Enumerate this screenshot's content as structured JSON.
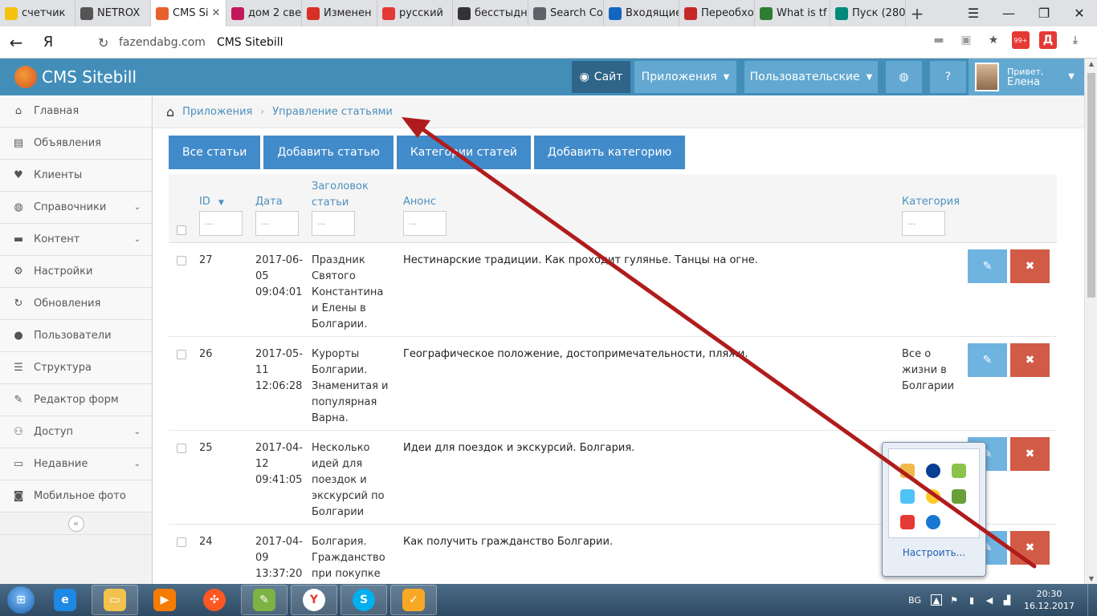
{
  "browser": {
    "tabs": [
      {
        "label": "счетчик",
        "color": "#f4c20d"
      },
      {
        "label": "NETROX",
        "color": "#555555"
      },
      {
        "label": "CMS Si",
        "color": "#e8612c",
        "active": true
      },
      {
        "label": "дом 2 све",
        "color": "#c2185b"
      },
      {
        "label": "Изменен",
        "color": "#d93025"
      },
      {
        "label": "русский",
        "color": "#e53935"
      },
      {
        "label": "бесстыдн",
        "color": "#333333"
      },
      {
        "label": "Search Co",
        "color": "#5f6368"
      },
      {
        "label": "Входящие",
        "color": "#1565c0"
      },
      {
        "label": "Переобхо",
        "color": "#c62828"
      },
      {
        "label": "What is tf",
        "color": "#2e7d32"
      },
      {
        "label": "Пуск (280",
        "color": "#00897b"
      }
    ],
    "tab_close": "✕",
    "new_tab": "+",
    "window_controls": [
      "☰",
      "—",
      "❐",
      "✕"
    ],
    "address": {
      "back": "←",
      "ya": "Я",
      "host": "fazendabg.com",
      "title": "CMS Sitebill",
      "yandex_badge": "99+",
      "d_label": "Д"
    }
  },
  "cms": {
    "brand": "CMS Sitebill",
    "buttons": {
      "site": "Сайт",
      "apps": "Приложения",
      "custom": "Пользовательские"
    },
    "user": {
      "greeting": "Привет,",
      "name": "Елена"
    },
    "sidebar": [
      {
        "label": "Главная",
        "icon": "home-icon",
        "glyph": "⌂",
        "expand": false
      },
      {
        "label": "Объявления",
        "icon": "book-icon",
        "glyph": "▤",
        "expand": false
      },
      {
        "label": "Клиенты",
        "icon": "heart-icon",
        "glyph": "♥",
        "expand": false
      },
      {
        "label": "Справочники",
        "icon": "globe-icon",
        "glyph": "◍",
        "expand": true
      },
      {
        "label": "Контент",
        "icon": "keyboard-icon",
        "glyph": "▬",
        "expand": true
      },
      {
        "label": "Настройки",
        "icon": "cog-icon",
        "glyph": "⚙",
        "expand": false
      },
      {
        "label": "Обновления",
        "icon": "refresh-icon",
        "glyph": "↻",
        "expand": false
      },
      {
        "label": "Пользователи",
        "icon": "user-icon",
        "glyph": "●",
        "expand": false
      },
      {
        "label": "Структура",
        "icon": "list-icon",
        "glyph": "☰",
        "expand": false
      },
      {
        "label": "Редактор форм",
        "icon": "edit-icon",
        "glyph": "✎",
        "expand": false
      },
      {
        "label": "Доступ",
        "icon": "users-icon",
        "glyph": "⚇",
        "expand": true
      },
      {
        "label": "Недавние",
        "icon": "desktop-icon",
        "glyph": "▭",
        "expand": true
      },
      {
        "label": "Мобильное фото",
        "icon": "camera-icon",
        "glyph": "◙",
        "expand": false
      }
    ],
    "breadcrumb": [
      "Приложения",
      "Управление статьями"
    ],
    "tabs": [
      "Все статьи",
      "Добавить статью",
      "Категории статей",
      "Добавить категорию"
    ],
    "table": {
      "headers": {
        "id": "ID",
        "date": "Дата",
        "title_line1": "Заголовок",
        "title_line2": "статьи",
        "anons": "Анонс",
        "category": "Категория"
      },
      "filter_placeholder": "...",
      "rows": [
        {
          "id": "27",
          "date": "2017-06-05 09:04:01",
          "title": "Праздник Святого Константина и Елены в Болгарии.",
          "anons": "Нестинарские традиции. Как проходит гулянье. Танцы на огне.",
          "category": ""
        },
        {
          "id": "26",
          "date": "2017-05-11 12:06:28",
          "title": "Курорты Болгарии. Знаменитая и популярная Варна.",
          "anons": "Географическое положение, достопримечательности, пляжи.",
          "category": "Все о жизни в Болгарии"
        },
        {
          "id": "25",
          "date": "2017-04-12 09:41:05",
          "title": "Несколько идей для поездок и экскурсий по Болгарии",
          "anons": "Идеи для поездок и экскурсий. Болгария.",
          "category": ""
        },
        {
          "id": "24",
          "date": "2017-04-09 13:37:20",
          "title": "Болгария. Гражданство при покупке",
          "anons": "Как получить гражданство Болгарии.",
          "category": ""
        }
      ]
    }
  },
  "tray_popup": {
    "link": "Настроить..."
  },
  "taskbar": {
    "lang": "BG",
    "time": "20:30",
    "date": "16.12.2017"
  },
  "colors": {
    "header": "#438eb9",
    "tab_button": "#428bca",
    "edit": "#6fb3e0",
    "delete": "#d15b47",
    "arrow": "#b01c1c"
  }
}
